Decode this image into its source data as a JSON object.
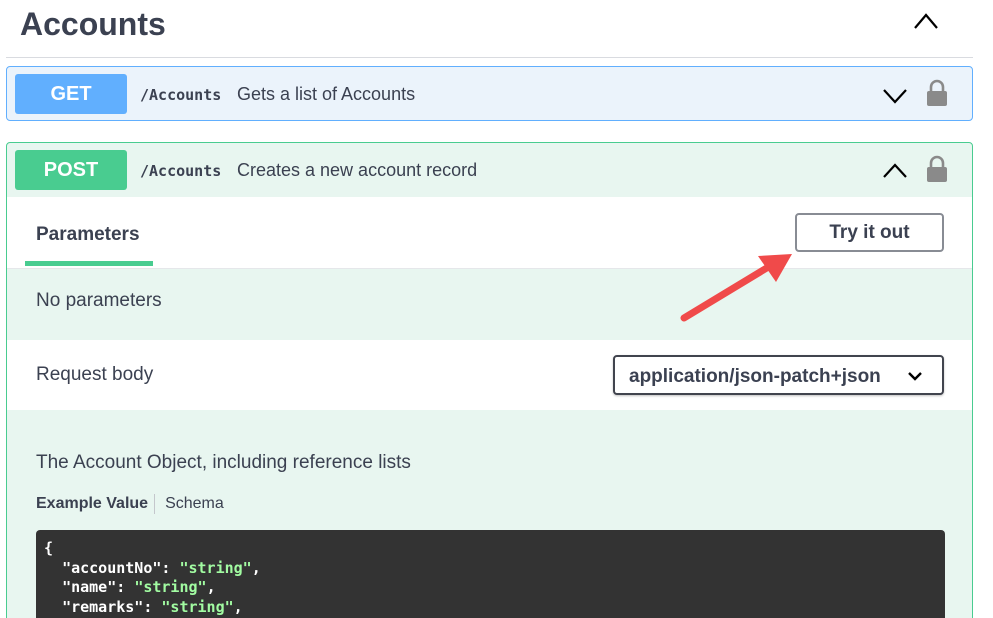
{
  "section": {
    "title": "Accounts"
  },
  "get_op": {
    "method": "GET",
    "path": "/Accounts",
    "description": "Gets a list of Accounts"
  },
  "post_op": {
    "method": "POST",
    "path": "/Accounts",
    "description": "Creates a new account record",
    "tab_label": "Parameters",
    "try_button": "Try it out",
    "no_params": "No parameters",
    "request_body_label": "Request body",
    "content_type": "application/json-patch+json",
    "model_description": "The Account Object, including reference lists",
    "model_tabs": {
      "example": "Example Value",
      "schema": "Schema"
    },
    "example_code": {
      "open": "{",
      "lines": [
        {
          "key": "\"accountNo\"",
          "value": "\"string\""
        },
        {
          "key": "\"name\"",
          "value": "\"string\""
        },
        {
          "key": "\"remarks\"",
          "value": "\"string\""
        }
      ]
    }
  },
  "colors": {
    "get": "#61affe",
    "post": "#49cc90",
    "annotation_arrow": "#f04a4a"
  },
  "icons": {
    "section_toggle": "chevron-up-icon",
    "get_toggle": "chevron-down-icon",
    "post_toggle": "chevron-up-icon",
    "lock": "lock-icon",
    "select": "chevron-down-icon"
  }
}
